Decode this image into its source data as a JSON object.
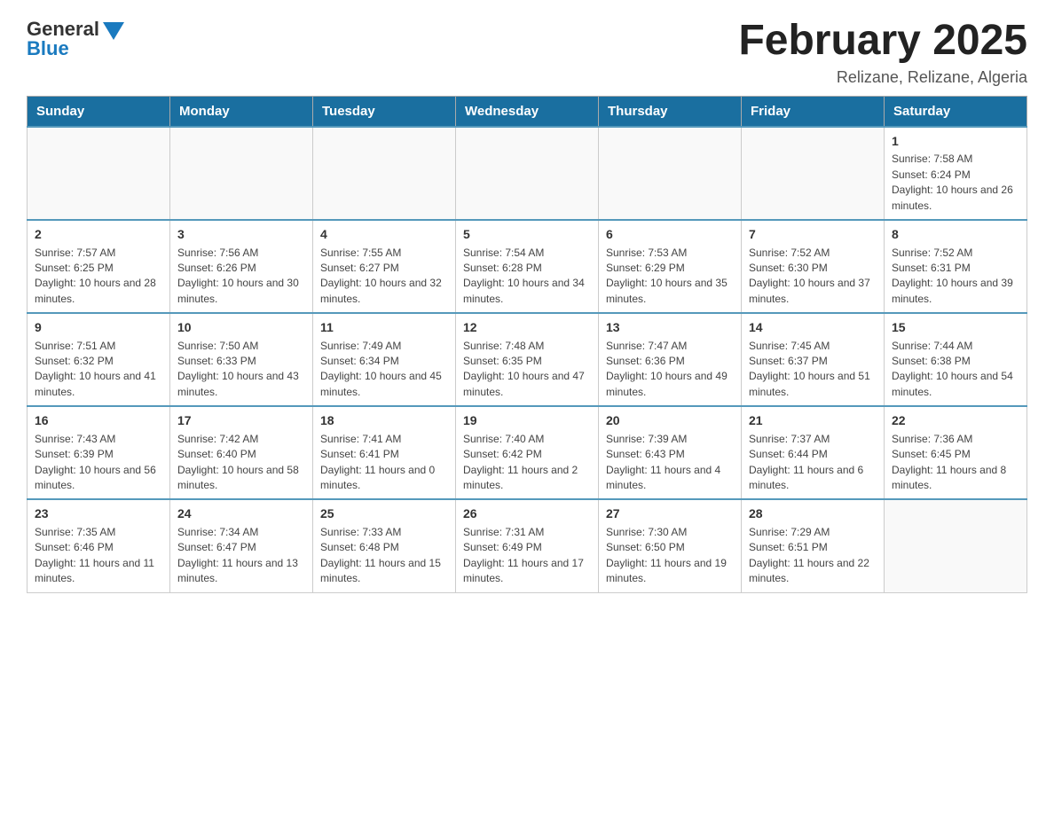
{
  "header": {
    "logo_general": "General",
    "logo_blue": "Blue",
    "title": "February 2025",
    "subtitle": "Relizane, Relizane, Algeria"
  },
  "days_of_week": [
    "Sunday",
    "Monday",
    "Tuesday",
    "Wednesday",
    "Thursday",
    "Friday",
    "Saturday"
  ],
  "weeks": [
    [
      {
        "day": "",
        "info": ""
      },
      {
        "day": "",
        "info": ""
      },
      {
        "day": "",
        "info": ""
      },
      {
        "day": "",
        "info": ""
      },
      {
        "day": "",
        "info": ""
      },
      {
        "day": "",
        "info": ""
      },
      {
        "day": "1",
        "info": "Sunrise: 7:58 AM\nSunset: 6:24 PM\nDaylight: 10 hours and 26 minutes."
      }
    ],
    [
      {
        "day": "2",
        "info": "Sunrise: 7:57 AM\nSunset: 6:25 PM\nDaylight: 10 hours and 28 minutes."
      },
      {
        "day": "3",
        "info": "Sunrise: 7:56 AM\nSunset: 6:26 PM\nDaylight: 10 hours and 30 minutes."
      },
      {
        "day": "4",
        "info": "Sunrise: 7:55 AM\nSunset: 6:27 PM\nDaylight: 10 hours and 32 minutes."
      },
      {
        "day": "5",
        "info": "Sunrise: 7:54 AM\nSunset: 6:28 PM\nDaylight: 10 hours and 34 minutes."
      },
      {
        "day": "6",
        "info": "Sunrise: 7:53 AM\nSunset: 6:29 PM\nDaylight: 10 hours and 35 minutes."
      },
      {
        "day": "7",
        "info": "Sunrise: 7:52 AM\nSunset: 6:30 PM\nDaylight: 10 hours and 37 minutes."
      },
      {
        "day": "8",
        "info": "Sunrise: 7:52 AM\nSunset: 6:31 PM\nDaylight: 10 hours and 39 minutes."
      }
    ],
    [
      {
        "day": "9",
        "info": "Sunrise: 7:51 AM\nSunset: 6:32 PM\nDaylight: 10 hours and 41 minutes."
      },
      {
        "day": "10",
        "info": "Sunrise: 7:50 AM\nSunset: 6:33 PM\nDaylight: 10 hours and 43 minutes."
      },
      {
        "day": "11",
        "info": "Sunrise: 7:49 AM\nSunset: 6:34 PM\nDaylight: 10 hours and 45 minutes."
      },
      {
        "day": "12",
        "info": "Sunrise: 7:48 AM\nSunset: 6:35 PM\nDaylight: 10 hours and 47 minutes."
      },
      {
        "day": "13",
        "info": "Sunrise: 7:47 AM\nSunset: 6:36 PM\nDaylight: 10 hours and 49 minutes."
      },
      {
        "day": "14",
        "info": "Sunrise: 7:45 AM\nSunset: 6:37 PM\nDaylight: 10 hours and 51 minutes."
      },
      {
        "day": "15",
        "info": "Sunrise: 7:44 AM\nSunset: 6:38 PM\nDaylight: 10 hours and 54 minutes."
      }
    ],
    [
      {
        "day": "16",
        "info": "Sunrise: 7:43 AM\nSunset: 6:39 PM\nDaylight: 10 hours and 56 minutes."
      },
      {
        "day": "17",
        "info": "Sunrise: 7:42 AM\nSunset: 6:40 PM\nDaylight: 10 hours and 58 minutes."
      },
      {
        "day": "18",
        "info": "Sunrise: 7:41 AM\nSunset: 6:41 PM\nDaylight: 11 hours and 0 minutes."
      },
      {
        "day": "19",
        "info": "Sunrise: 7:40 AM\nSunset: 6:42 PM\nDaylight: 11 hours and 2 minutes."
      },
      {
        "day": "20",
        "info": "Sunrise: 7:39 AM\nSunset: 6:43 PM\nDaylight: 11 hours and 4 minutes."
      },
      {
        "day": "21",
        "info": "Sunrise: 7:37 AM\nSunset: 6:44 PM\nDaylight: 11 hours and 6 minutes."
      },
      {
        "day": "22",
        "info": "Sunrise: 7:36 AM\nSunset: 6:45 PM\nDaylight: 11 hours and 8 minutes."
      }
    ],
    [
      {
        "day": "23",
        "info": "Sunrise: 7:35 AM\nSunset: 6:46 PM\nDaylight: 11 hours and 11 minutes."
      },
      {
        "day": "24",
        "info": "Sunrise: 7:34 AM\nSunset: 6:47 PM\nDaylight: 11 hours and 13 minutes."
      },
      {
        "day": "25",
        "info": "Sunrise: 7:33 AM\nSunset: 6:48 PM\nDaylight: 11 hours and 15 minutes."
      },
      {
        "day": "26",
        "info": "Sunrise: 7:31 AM\nSunset: 6:49 PM\nDaylight: 11 hours and 17 minutes."
      },
      {
        "day": "27",
        "info": "Sunrise: 7:30 AM\nSunset: 6:50 PM\nDaylight: 11 hours and 19 minutes."
      },
      {
        "day": "28",
        "info": "Sunrise: 7:29 AM\nSunset: 6:51 PM\nDaylight: 11 hours and 22 minutes."
      },
      {
        "day": "",
        "info": ""
      }
    ]
  ]
}
